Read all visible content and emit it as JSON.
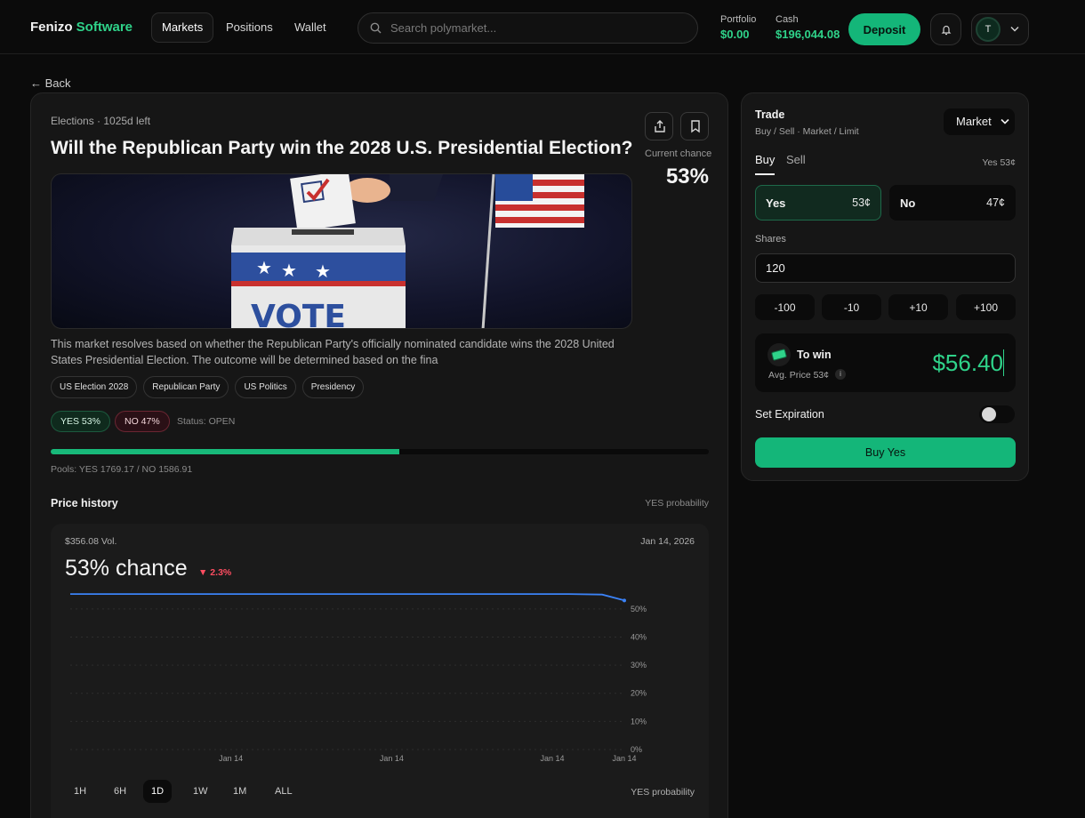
{
  "header": {
    "brand_main": "Fenizo",
    "brand_accent": "Software",
    "nav": [
      {
        "label": "Markets",
        "active": true
      },
      {
        "label": "Positions",
        "active": false
      },
      {
        "label": "Wallet",
        "active": false
      }
    ],
    "search_placeholder": "Search polymarket...",
    "portfolio_label": "Portfolio",
    "portfolio_value": "$0.00",
    "cash_label": "Cash",
    "cash_value": "$196,044.08",
    "deposit_label": "Deposit",
    "avatar_initial": "T",
    "accent_color": "#14b679"
  },
  "back_label": "← Back",
  "market": {
    "meta": "Elections · 1025d left",
    "title": "Will the Republican Party win the 2028 U.S. Presidential Election?",
    "current_chance_label": "Current chance",
    "current_chance": "53%",
    "hero_text": "VOTE",
    "description": "This market resolves based on whether the Republican Party's officially nominated candidate wins the 2028 United States Presidential Election. The outcome will be determined based on the fina",
    "tags": [
      "US Election 2028",
      "Republican Party",
      "US Politics",
      "Presidency"
    ],
    "yes_pill": "YES 53%",
    "no_pill": "NO 47%",
    "status": "Status: OPEN",
    "yes_fraction": 0.53,
    "pools": "Pools: YES 1769.17 / NO 1586.91",
    "price_history_title": "Price history",
    "price_history_right": "YES probability"
  },
  "chart_panel": {
    "volume": "$356.08 Vol.",
    "date": "Jan 14, 2026",
    "chance": "53% chance",
    "delta": "▼ 2.3%",
    "timeframes": [
      "1H",
      "6H",
      "1D",
      "1W",
      "1M",
      "ALL"
    ],
    "active_timeframe": "1D",
    "footer_right": "YES probability"
  },
  "chart_data": {
    "type": "line",
    "x_tick_labels": [
      "Jan 14",
      "Jan 14",
      "Jan 14",
      "Jan 14"
    ],
    "y_tick_labels": [
      "50%",
      "40%",
      "30%",
      "20%",
      "10%",
      "0%"
    ],
    "ylim": [
      0,
      55
    ],
    "series": [
      {
        "color": "#3b82f6",
        "x": [
          0,
          0.1,
          0.2,
          0.3,
          0.4,
          0.5,
          0.6,
          0.7,
          0.8,
          0.9,
          0.96,
          1.0
        ],
        "y": [
          55.3,
          55.3,
          55.3,
          55.3,
          55.3,
          55.3,
          55.3,
          55.3,
          55.3,
          55.3,
          55.1,
          53
        ]
      }
    ],
    "grid": true,
    "legend": "none"
  },
  "trade": {
    "title": "Trade",
    "subtitle": "Buy / Sell · Market / Limit",
    "order_type": "Market",
    "tab_buy": "Buy",
    "tab_sell": "Sell",
    "yes_price_label": "Yes 53¢",
    "yes_label": "Yes",
    "yes_price": "53¢",
    "no_label": "No",
    "no_price": "47¢",
    "shares_label": "Shares",
    "shares_value": "120",
    "steps": [
      "-100",
      "-10",
      "+10",
      "+100"
    ],
    "to_win_label": "To win",
    "avg_price": "Avg. Price 53¢",
    "info_glyph": "i",
    "to_win_amount": "$56.40",
    "expiration_label": "Set Expiration",
    "buy_button": "Buy Yes"
  }
}
